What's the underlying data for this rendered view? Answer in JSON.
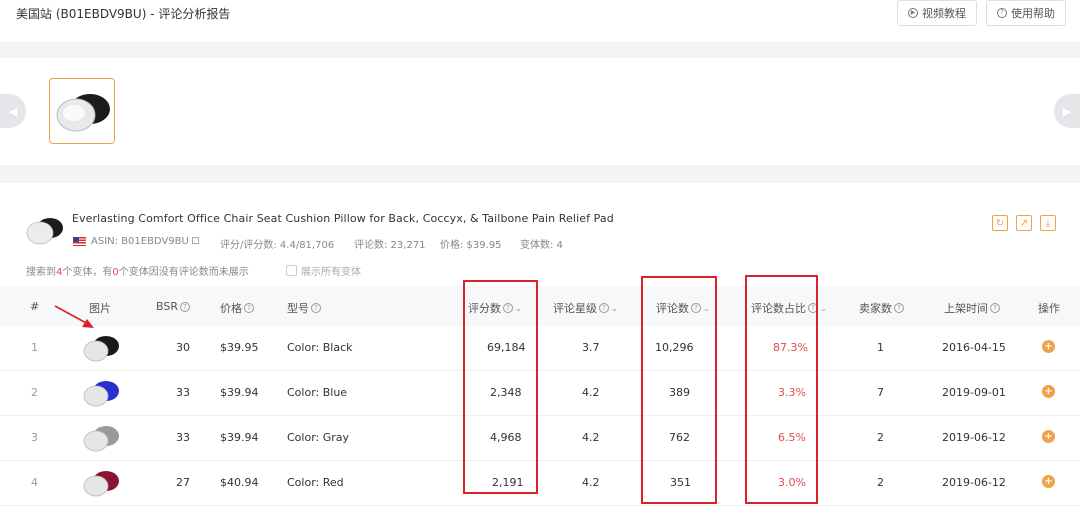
{
  "header": {
    "title": "美国站 (B01EBDV9BU) - 评论分析报告",
    "video_tutorial": "视频教程",
    "help": "使用帮助"
  },
  "product": {
    "title": "Everlasting Comfort Office Chair Seat Cushion Pillow for Back, Coccyx, & Tailbone Pain Relief Pad",
    "asin": "ASIN: B01EBDV9BU",
    "rating": "评分/评分数: 4.4/81,706",
    "reviews": "评论数: 23,271",
    "price": "价格: $39.95",
    "variants": "变体数: 4"
  },
  "note": {
    "part1": "搜索到",
    "count1": "4",
    "part2": "个变体，有",
    "count2": "0",
    "part3": "个变体因没有评论数而未展示",
    "show_all": "展示所有变体"
  },
  "columns": {
    "idx": "#",
    "image": "图片",
    "bsr": "BSR",
    "price": "价格",
    "model": "型号",
    "rating_count": "评分数",
    "star": "评论星级",
    "review_count": "评论数",
    "review_share": "评论数占比",
    "sellers": "卖家数",
    "launch": "上架时间",
    "ops": "操作"
  },
  "rows": [
    {
      "idx": "1",
      "bsr": "30",
      "price": "$39.95",
      "model": "Color: Black",
      "rating_count": "69,184",
      "star": "3.7",
      "review_count": "10,296",
      "share": "87.3%",
      "sellers": "1",
      "launch": "2016-04-15",
      "color": "#1a1a1a"
    },
    {
      "idx": "2",
      "bsr": "33",
      "price": "$39.94",
      "model": "Color: Blue",
      "rating_count": "2,348",
      "star": "4.2",
      "review_count": "389",
      "share": "3.3%",
      "sellers": "7",
      "launch": "2019-09-01",
      "color": "#2b2fd0"
    },
    {
      "idx": "3",
      "bsr": "33",
      "price": "$39.94",
      "model": "Color: Gray",
      "rating_count": "4,968",
      "star": "4.2",
      "review_count": "762",
      "share": "6.5%",
      "sellers": "2",
      "launch": "2019-06-12",
      "color": "#9a9a9a"
    },
    {
      "idx": "4",
      "bsr": "27",
      "price": "$40.94",
      "model": "Color: Red",
      "rating_count": "2,191",
      "star": "4.2",
      "review_count": "351",
      "share": "3.0%",
      "sellers": "2",
      "launch": "2019-06-12",
      "color": "#8a1530"
    }
  ],
  "colors": {
    "accent": "#f0a14a",
    "highlight": "#d9222a",
    "percent_red": "#e34b4b"
  }
}
